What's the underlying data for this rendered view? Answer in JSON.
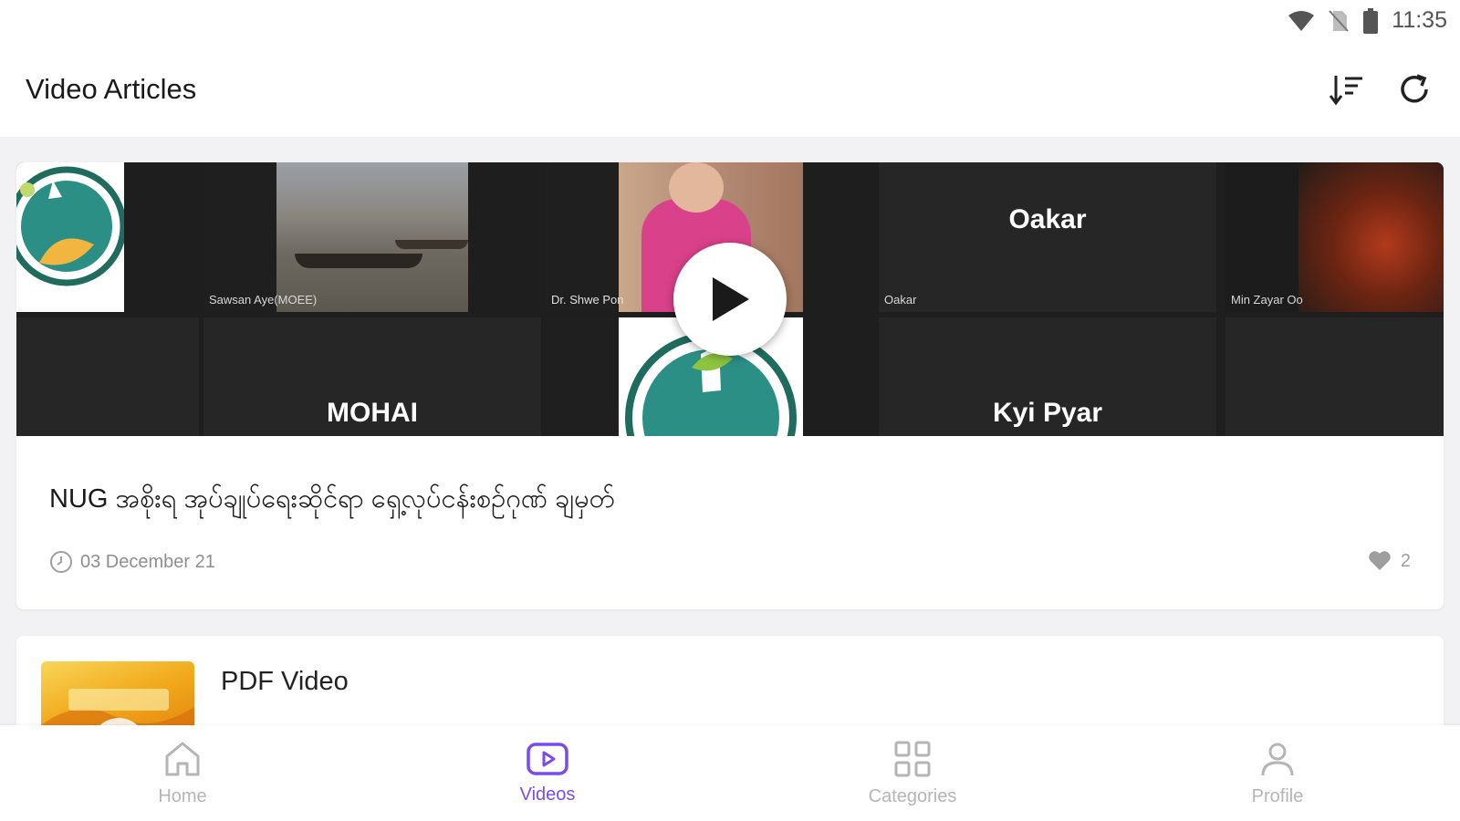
{
  "status_bar": {
    "time": "11:35"
  },
  "app_bar": {
    "title": "Video Articles"
  },
  "featured": {
    "title": "NUG အစိုးရ အုပ်ချုပ်ရေးဆိုင်ရာ ရှေ့လုပ်ငန်းစဉ်ဂုဏ် ချမှတ်",
    "date": "03 December 21",
    "likes": "2",
    "participants": {
      "p1": "Sawsan Aye(MOEE)",
      "p2": "Dr. Shwe Pon",
      "p3": "Oakar",
      "p4": "Min Zayar Oo",
      "big1": "Oakar",
      "big2": "MOHAI",
      "big3": "Kyi Pyar"
    }
  },
  "second": {
    "title": "PDF Video"
  },
  "bottom_nav": {
    "items": [
      {
        "label": "Home"
      },
      {
        "label": "Videos"
      },
      {
        "label": "Categories"
      },
      {
        "label": "Profile"
      }
    ]
  },
  "colors": {
    "accent": "#7a4cf0",
    "inactive": "#b5b5b5"
  }
}
